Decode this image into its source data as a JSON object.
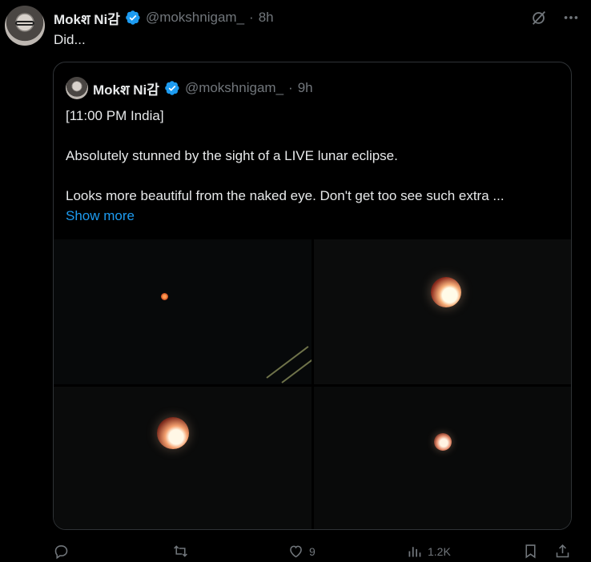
{
  "tweet": {
    "author": {
      "name": "Mokश Ni감",
      "handle": "@mokshnigam_",
      "time": "8h",
      "separator": "·"
    },
    "text": "Did..."
  },
  "quote": {
    "author": {
      "name": "Mokश Ni감",
      "handle": "@mokshnigam_",
      "time": "9h",
      "separator": "·"
    },
    "lines": [
      "[11:00 PM India]",
      "Absolutely stunned by the sight of a LIVE lunar eclipse.",
      "Looks more beautiful from the naked eye. Don't get too see such extra ..."
    ],
    "show_more": "Show more"
  },
  "actions": {
    "reply_count": "",
    "retweet_count": "",
    "like_count": "9",
    "view_count": "1.2K"
  },
  "icons": [
    "grok-icon",
    "more-icon",
    "verified-icon",
    "reply-icon",
    "retweet-icon",
    "like-icon",
    "views-icon",
    "bookmark-icon",
    "share-icon"
  ],
  "colors": {
    "background": "#000000",
    "text": "#e7e9ea",
    "muted": "#71767b",
    "accent": "#1d9bf0",
    "border": "#2f3336"
  }
}
